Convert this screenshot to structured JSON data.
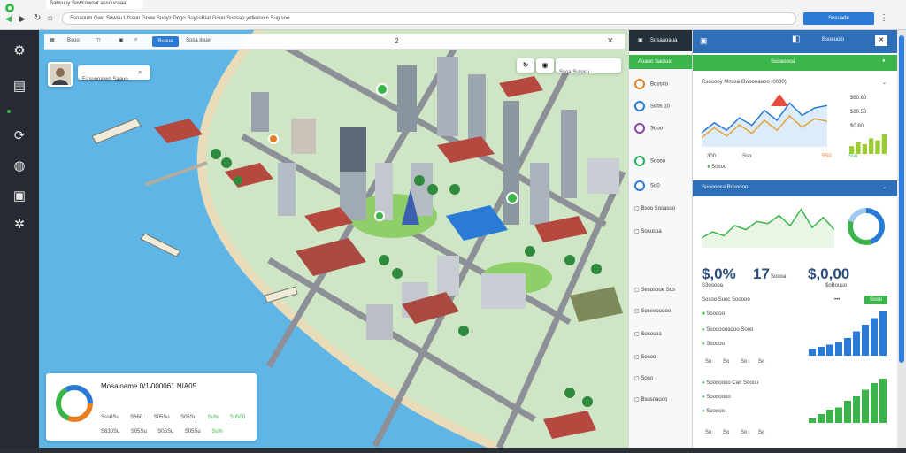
{
  "browser": {
    "tab_title": "Sabsuuy Sowcowoat assoucoaa",
    "url": "Ssoaoum Gwo Sowsu Ufsson Grww Suoyz Dngo SuyssBiat Goon Sunsao yotkenoin Sug soo",
    "profile_label": "Sosuade"
  },
  "rail": {
    "icons": [
      "gear-icon",
      "monitor-icon",
      "status-dot-icon",
      "refresh-icon",
      "globe-icon",
      "cluster-icon"
    ]
  },
  "toolbar": {
    "item_1": "Bsoo",
    "search_label": "Buaue",
    "search_hint": "Sosa iisue",
    "page_number": "2"
  },
  "user_card": {
    "name": "Easuooaiwo Saauo"
  },
  "map_controls": {
    "layers_label": "Ssoa Sutosu"
  },
  "bottom_card": {
    "title": "Mosaioame 0/1\\000061 NIA05",
    "row1": [
      "Sss0Su",
      "S660",
      "S05Su",
      "S05Su",
      "Su%",
      "Su500"
    ],
    "row2": [
      "S630Su",
      "S05Su",
      "S05Su",
      "S05Su",
      "Su%"
    ]
  },
  "side_list": {
    "header": "Sosaaoaua",
    "subheader": "Aoaoo Saosuo",
    "items": [
      {
        "label": "Bousco",
        "color": "#e67e22"
      },
      {
        "label": "Soos 10",
        "color": "#2a7bd5"
      },
      {
        "label": "Sooo",
        "color": "#8e44ad"
      },
      {
        "label": "Sooso",
        "color": "#27ae60"
      },
      {
        "label": "So0",
        "color": "#2a7bd5"
      }
    ],
    "items2": [
      "Bsoo Sosasuo",
      "Sosusoa",
      "Sesosoue Sos",
      "Soseeouooo",
      "Sososoa",
      "Sosoo",
      "Soso",
      "Bsusoauoo"
    ]
  },
  "panel": {
    "header": "Bsoeuoio",
    "green_bar": "Sooaoooa",
    "chart1_title": "Rsooooy Mnssa Owsooaaoo (0080)",
    "chart1_values": [
      "$60.60",
      "$60.50",
      "$0.60"
    ],
    "chart1_ticks": [
      "300",
      "Sso",
      "5S0",
      "Sso"
    ],
    "chart1_legend": "Sosoo",
    "blue_bar": "Suoooosa Bosoooo",
    "metrics": [
      "$,0%",
      "17",
      "$,0,00"
    ],
    "metric_sub": [
      "S3ooooa",
      "Soooa",
      "$oBouuo"
    ],
    "section3_title": "Sosoo Suoc Sooooo",
    "section3_button": "Sooo",
    "section3_rows": [
      "Sooooo",
      "Sooooooaooo Sooo",
      "Sooooo"
    ],
    "section4_rows": [
      "Sooooooo Cao Sooou",
      "Sooooooo",
      "Sooooo"
    ],
    "axis_ticks": [
      "So",
      "So",
      "So",
      "So"
    ],
    "chart1_data": [
      0.25,
      0.45,
      0.3,
      0.55,
      0.4,
      0.7,
      0.5,
      0.85,
      0.6,
      0.75,
      0.8
    ],
    "chart2_data": [
      0.2,
      0.35,
      0.25,
      0.5,
      0.4,
      0.6,
      0.55,
      0.75,
      0.5,
      0.9,
      0.45,
      0.7,
      0.4
    ],
    "bars1": [
      0.15,
      0.2,
      0.25,
      0.3,
      0.4,
      0.55,
      0.7,
      0.85,
      1.0
    ],
    "bars2": [
      0.1,
      0.2,
      0.3,
      0.35,
      0.5,
      0.6,
      0.75,
      0.9,
      1.0
    ],
    "donut": [
      0.45,
      0.35,
      0.2
    ]
  },
  "colors": {
    "accent_blue": "#2a7bd5",
    "green": "#3bb54a",
    "panel_blue": "#2d6fb8",
    "water": "#5fb6e6"
  }
}
